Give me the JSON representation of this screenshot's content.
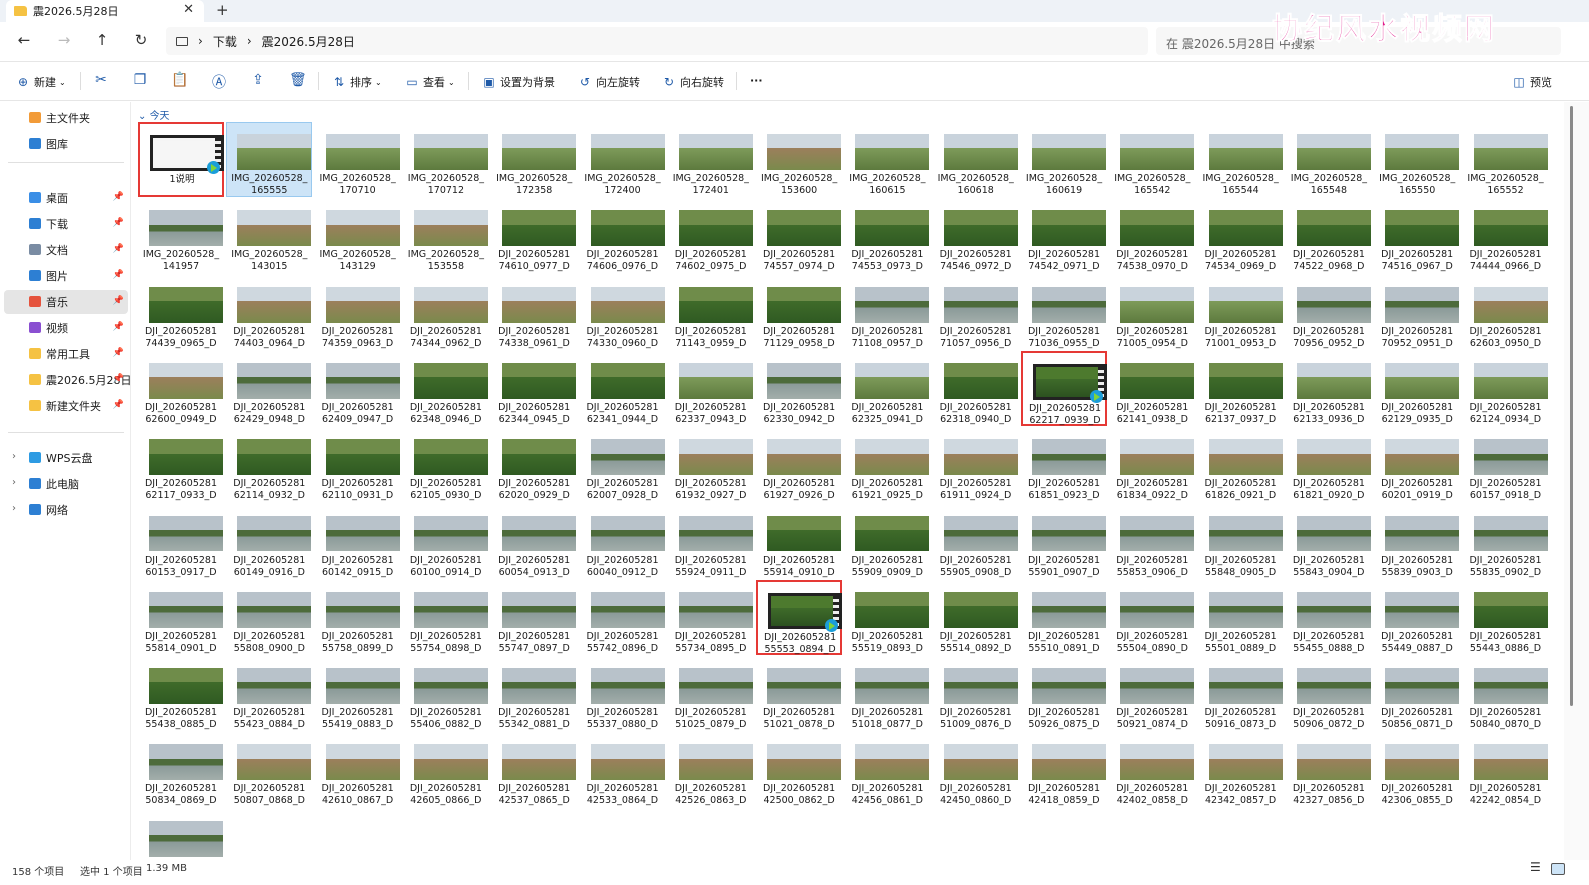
{
  "tab": {
    "title": "震2026.5月28日"
  },
  "watermark": "协纪风水视频网",
  "address": {
    "breadcrumb": [
      "下载",
      "震2026.5月28日"
    ],
    "search_placeholder": "在 震2026.5月28日 中搜索"
  },
  "toolbar": {
    "new": "新建",
    "sort": "排序",
    "view": "查看",
    "set_bg": "设置为背景",
    "rotate_left": "向左旋转",
    "rotate_right": "向右旋转",
    "more": "···",
    "preview": "预览"
  },
  "sidebar": {
    "home": "主文件夹",
    "gallery": "图库",
    "pinned": [
      {
        "label": "桌面"
      },
      {
        "label": "下载"
      },
      {
        "label": "文档"
      },
      {
        "label": "图片"
      },
      {
        "label": "音乐"
      },
      {
        "label": "视频"
      },
      {
        "label": "常用工具"
      },
      {
        "label": "震2026.5月28日"
      },
      {
        "label": "新建文件夹"
      }
    ],
    "drives": [
      {
        "label": "WPS云盘"
      },
      {
        "label": "此电脑"
      },
      {
        "label": "网络"
      }
    ]
  },
  "content": {
    "group": "今天"
  },
  "files": [
    [
      "1说明",
      "",
      "doc",
      1
    ],
    [
      "IMG_20260528_",
      "165555",
      "wide",
      0
    ],
    [
      "IMG_20260528_",
      "170710",
      "wide",
      0
    ],
    [
      "IMG_20260528_",
      "170712",
      "wide",
      0
    ],
    [
      "IMG_20260528_",
      "172358",
      "wide",
      0
    ],
    [
      "IMG_20260528_",
      "172400",
      "wide",
      0
    ],
    [
      "IMG_20260528_",
      "172401",
      "wide",
      0
    ],
    [
      "IMG_20260528_",
      "153600",
      "field",
      0
    ],
    [
      "IMG_20260528_",
      "160615",
      "wide",
      0
    ],
    [
      "IMG_20260528_",
      "160618",
      "wide",
      0
    ],
    [
      "IMG_20260528_",
      "160619",
      "wide",
      0
    ],
    [
      "IMG_20260528_",
      "165542",
      "wide",
      0
    ],
    [
      "IMG_20260528_",
      "165544",
      "wide",
      0
    ],
    [
      "IMG_20260528_",
      "165548",
      "wide",
      0
    ],
    [
      "IMG_20260528_",
      "165550",
      "wide",
      0
    ],
    [
      "IMG_20260528_",
      "165552",
      "wide",
      0
    ],
    [
      "IMG_20260528_",
      "141957",
      "lake",
      0
    ],
    [
      "IMG_20260528_",
      "143015",
      "field",
      0
    ],
    [
      "IMG_20260528_",
      "143129",
      "field",
      0
    ],
    [
      "IMG_20260528_",
      "153558",
      "field",
      0
    ],
    [
      "DJI_202605281",
      "74610_0977_D",
      "forest",
      0
    ],
    [
      "DJI_202605281",
      "74606_0976_D",
      "forest",
      0
    ],
    [
      "DJI_202605281",
      "74602_0975_D",
      "forest",
      0
    ],
    [
      "DJI_202605281",
      "74557_0974_D",
      "forest",
      0
    ],
    [
      "DJI_202605281",
      "74553_0973_D",
      "forest",
      0
    ],
    [
      "DJI_202605281",
      "74546_0972_D",
      "forest",
      0
    ],
    [
      "DJI_202605281",
      "74542_0971_D",
      "forest",
      0
    ],
    [
      "DJI_202605281",
      "74538_0970_D",
      "forest",
      0
    ],
    [
      "DJI_202605281",
      "74534_0969_D",
      "forest",
      0
    ],
    [
      "DJI_202605281",
      "74522_0968_D",
      "forest",
      0
    ],
    [
      "DJI_202605281",
      "74516_0967_D",
      "forest",
      0
    ],
    [
      "DJI_202605281",
      "74444_0966_D",
      "forest",
      0
    ],
    [
      "DJI_202605281",
      "74439_0965_D",
      "forest",
      0
    ],
    [
      "DJI_202605281",
      "74403_0964_D",
      "field",
      0
    ],
    [
      "DJI_202605281",
      "74359_0963_D",
      "field",
      0
    ],
    [
      "DJI_202605281",
      "74344_0962_D",
      "field",
      0
    ],
    [
      "DJI_202605281",
      "74338_0961_D",
      "field",
      0
    ],
    [
      "DJI_202605281",
      "74330_0960_D",
      "field",
      0
    ],
    [
      "DJI_202605281",
      "71143_0959_D",
      "forest",
      0
    ],
    [
      "DJI_202605281",
      "71129_0958_D",
      "forest",
      0
    ],
    [
      "DJI_202605281",
      "71108_0957_D",
      "lake",
      0
    ],
    [
      "DJI_202605281",
      "71057_0956_D",
      "lake",
      0
    ],
    [
      "DJI_202605281",
      "71036_0955_D",
      "lake",
      0
    ],
    [
      "DJI_202605281",
      "71005_0954_D",
      "wide",
      0
    ],
    [
      "DJI_202605281",
      "71001_0953_D",
      "wide",
      0
    ],
    [
      "DJI_202605281",
      "70956_0952_D",
      "lake",
      0
    ],
    [
      "DJI_202605281",
      "70952_0951_D",
      "lake",
      0
    ],
    [
      "DJI_202605281",
      "62603_0950_D",
      "field",
      0
    ],
    [
      "DJI_202605281",
      "62600_0949_D",
      "field",
      0
    ],
    [
      "DJI_202605281",
      "62429_0948_D",
      "lake",
      0
    ],
    [
      "DJI_202605281",
      "62409_0947_D",
      "lake",
      0
    ],
    [
      "DJI_202605281",
      "62348_0946_D",
      "forest",
      0
    ],
    [
      "DJI_202605281",
      "62344_0945_D",
      "forest",
      0
    ],
    [
      "DJI_202605281",
      "62341_0944_D",
      "forest",
      0
    ],
    [
      "DJI_202605281",
      "62337_0943_D",
      "wide",
      0
    ],
    [
      "DJI_202605281",
      "62330_0942_D",
      "lake",
      0
    ],
    [
      "DJI_202605281",
      "62325_0941_D",
      "wide",
      0
    ],
    [
      "DJI_202605281",
      "62318_0940_D",
      "forest",
      0
    ],
    [
      "DJI_202605281",
      "62217_0939_D",
      "video",
      1
    ],
    [
      "DJI_202605281",
      "62141_0938_D",
      "forest",
      0
    ],
    [
      "DJI_202605281",
      "62137_0937_D",
      "forest",
      0
    ],
    [
      "DJI_202605281",
      "62133_0936_D",
      "wide",
      0
    ],
    [
      "DJI_202605281",
      "62129_0935_D",
      "wide",
      0
    ],
    [
      "DJI_202605281",
      "62124_0934_D",
      "wide",
      0
    ],
    [
      "DJI_202605281",
      "62117_0933_D",
      "forest",
      0
    ],
    [
      "DJI_202605281",
      "62114_0932_D",
      "forest",
      0
    ],
    [
      "DJI_202605281",
      "62110_0931_D",
      "forest",
      0
    ],
    [
      "DJI_202605281",
      "62105_0930_D",
      "forest",
      0
    ],
    [
      "DJI_202605281",
      "62020_0929_D",
      "forest",
      0
    ],
    [
      "DJI_202605281",
      "62007_0928_D",
      "lake",
      0
    ],
    [
      "DJI_202605281",
      "61932_0927_D",
      "field",
      0
    ],
    [
      "DJI_202605281",
      "61927_0926_D",
      "field",
      0
    ],
    [
      "DJI_202605281",
      "61921_0925_D",
      "field",
      0
    ],
    [
      "DJI_202605281",
      "61911_0924_D",
      "field",
      0
    ],
    [
      "DJI_202605281",
      "61851_0923_D",
      "lake",
      0
    ],
    [
      "DJI_202605281",
      "61834_0922_D",
      "field",
      0
    ],
    [
      "DJI_202605281",
      "61826_0921_D",
      "field",
      0
    ],
    [
      "DJI_202605281",
      "61821_0920_D",
      "field",
      0
    ],
    [
      "DJI_202605281",
      "60201_0919_D",
      "field",
      0
    ],
    [
      "DJI_202605281",
      "60157_0918_D",
      "lake",
      0
    ],
    [
      "DJI_202605281",
      "60153_0917_D",
      "lake",
      0
    ],
    [
      "DJI_202605281",
      "60149_0916_D",
      "lake",
      0
    ],
    [
      "DJI_202605281",
      "60142_0915_D",
      "lake",
      0
    ],
    [
      "DJI_202605281",
      "60100_0914_D",
      "lake",
      0
    ],
    [
      "DJI_202605281",
      "60054_0913_D",
      "lake",
      0
    ],
    [
      "DJI_202605281",
      "60040_0912_D",
      "lake",
      0
    ],
    [
      "DJI_202605281",
      "55924_0911_D",
      "lake",
      0
    ],
    [
      "DJI_202605281",
      "55914_0910_D",
      "forest",
      0
    ],
    [
      "DJI_202605281",
      "55909_0909_D",
      "forest",
      0
    ],
    [
      "DJI_202605281",
      "55905_0908_D",
      "lake",
      0
    ],
    [
      "DJI_202605281",
      "55901_0907_D",
      "lake",
      0
    ],
    [
      "DJI_202605281",
      "55853_0906_D",
      "lake",
      0
    ],
    [
      "DJI_202605281",
      "55848_0905_D",
      "lake",
      0
    ],
    [
      "DJI_202605281",
      "55843_0904_D",
      "lake",
      0
    ],
    [
      "DJI_202605281",
      "55839_0903_D",
      "lake",
      0
    ],
    [
      "DJI_202605281",
      "55835_0902_D",
      "lake",
      0
    ],
    [
      "DJI_202605281",
      "55814_0901_D",
      "lake",
      0
    ],
    [
      "DJI_202605281",
      "55808_0900_D",
      "lake",
      0
    ],
    [
      "DJI_202605281",
      "55758_0899_D",
      "lake",
      0
    ],
    [
      "DJI_202605281",
      "55754_0898_D",
      "lake",
      0
    ],
    [
      "DJI_202605281",
      "55747_0897_D",
      "lake",
      0
    ],
    [
      "DJI_202605281",
      "55742_0896_D",
      "lake",
      0
    ],
    [
      "DJI_202605281",
      "55734_0895_D",
      "lake",
      0
    ],
    [
      "DJI_202605281",
      "55553_0894_D",
      "video",
      1
    ],
    [
      "DJI_202605281",
      "55519_0893_D",
      "forest",
      0
    ],
    [
      "DJI_202605281",
      "55514_0892_D",
      "forest",
      0
    ],
    [
      "DJI_202605281",
      "55510_0891_D",
      "lake",
      0
    ],
    [
      "DJI_202605281",
      "55504_0890_D",
      "lake",
      0
    ],
    [
      "DJI_202605281",
      "55501_0889_D",
      "lake",
      0
    ],
    [
      "DJI_202605281",
      "55455_0888_D",
      "lake",
      0
    ],
    [
      "DJI_202605281",
      "55449_0887_D",
      "lake",
      0
    ],
    [
      "DJI_202605281",
      "55443_0886_D",
      "forest",
      0
    ],
    [
      "DJI_202605281",
      "55438_0885_D",
      "forest",
      0
    ],
    [
      "DJI_202605281",
      "55423_0884_D",
      "lake",
      0
    ],
    [
      "DJI_202605281",
      "55419_0883_D",
      "lake",
      0
    ],
    [
      "DJI_202605281",
      "55406_0882_D",
      "lake",
      0
    ],
    [
      "DJI_202605281",
      "55342_0881_D",
      "lake",
      0
    ],
    [
      "DJI_202605281",
      "55337_0880_D",
      "lake",
      0
    ],
    [
      "DJI_202605281",
      "51025_0879_D",
      "lake",
      0
    ],
    [
      "DJI_202605281",
      "51021_0878_D",
      "lake",
      0
    ],
    [
      "DJI_202605281",
      "51018_0877_D",
      "lake",
      0
    ],
    [
      "DJI_202605281",
      "51009_0876_D",
      "lake",
      0
    ],
    [
      "DJI_202605281",
      "50926_0875_D",
      "lake",
      0
    ],
    [
      "DJI_202605281",
      "50921_0874_D",
      "lake",
      0
    ],
    [
      "DJI_202605281",
      "50916_0873_D",
      "lake",
      0
    ],
    [
      "DJI_202605281",
      "50906_0872_D",
      "lake",
      0
    ],
    [
      "DJI_202605281",
      "50856_0871_D",
      "lake",
      0
    ],
    [
      "DJI_202605281",
      "50840_0870_D",
      "lake",
      0
    ],
    [
      "DJI_202605281",
      "50834_0869_D",
      "lake",
      0
    ],
    [
      "DJI_202605281",
      "50807_0868_D",
      "field",
      0
    ],
    [
      "DJI_202605281",
      "42610_0867_D",
      "field",
      0
    ],
    [
      "DJI_202605281",
      "42605_0866_D",
      "field",
      0
    ],
    [
      "DJI_202605281",
      "42537_0865_D",
      "field",
      0
    ],
    [
      "DJI_202605281",
      "42533_0864_D",
      "field",
      0
    ],
    [
      "DJI_202605281",
      "42526_0863_D",
      "field",
      0
    ],
    [
      "DJI_202605281",
      "42500_0862_D",
      "field",
      0
    ],
    [
      "DJI_202605281",
      "42456_0861_D",
      "field",
      0
    ],
    [
      "DJI_202605281",
      "42450_0860_D",
      "field",
      0
    ],
    [
      "DJI_202605281",
      "42418_0859_D",
      "field",
      0
    ],
    [
      "DJI_202605281",
      "42402_0858_D",
      "field",
      0
    ],
    [
      "DJI_202605281",
      "42342_0857_D",
      "field",
      0
    ],
    [
      "DJI_202605281",
      "42327_0856_D",
      "field",
      0
    ],
    [
      "DJI_202605281",
      "42306_0855_D",
      "field",
      0
    ],
    [
      "DJI_202605281",
      "42242_0854_D",
      "field",
      0
    ],
    [
      "",
      "",
      "lake",
      0
    ]
  ],
  "selected_index": 1,
  "status": {
    "count": "158 个项目",
    "selection": "选中 1 个项目",
    "size": "1.39 MB"
  },
  "colors": {
    "accent": "#1f5aa8",
    "highlight_border": "#e53935",
    "watermark": "#e0198a"
  }
}
